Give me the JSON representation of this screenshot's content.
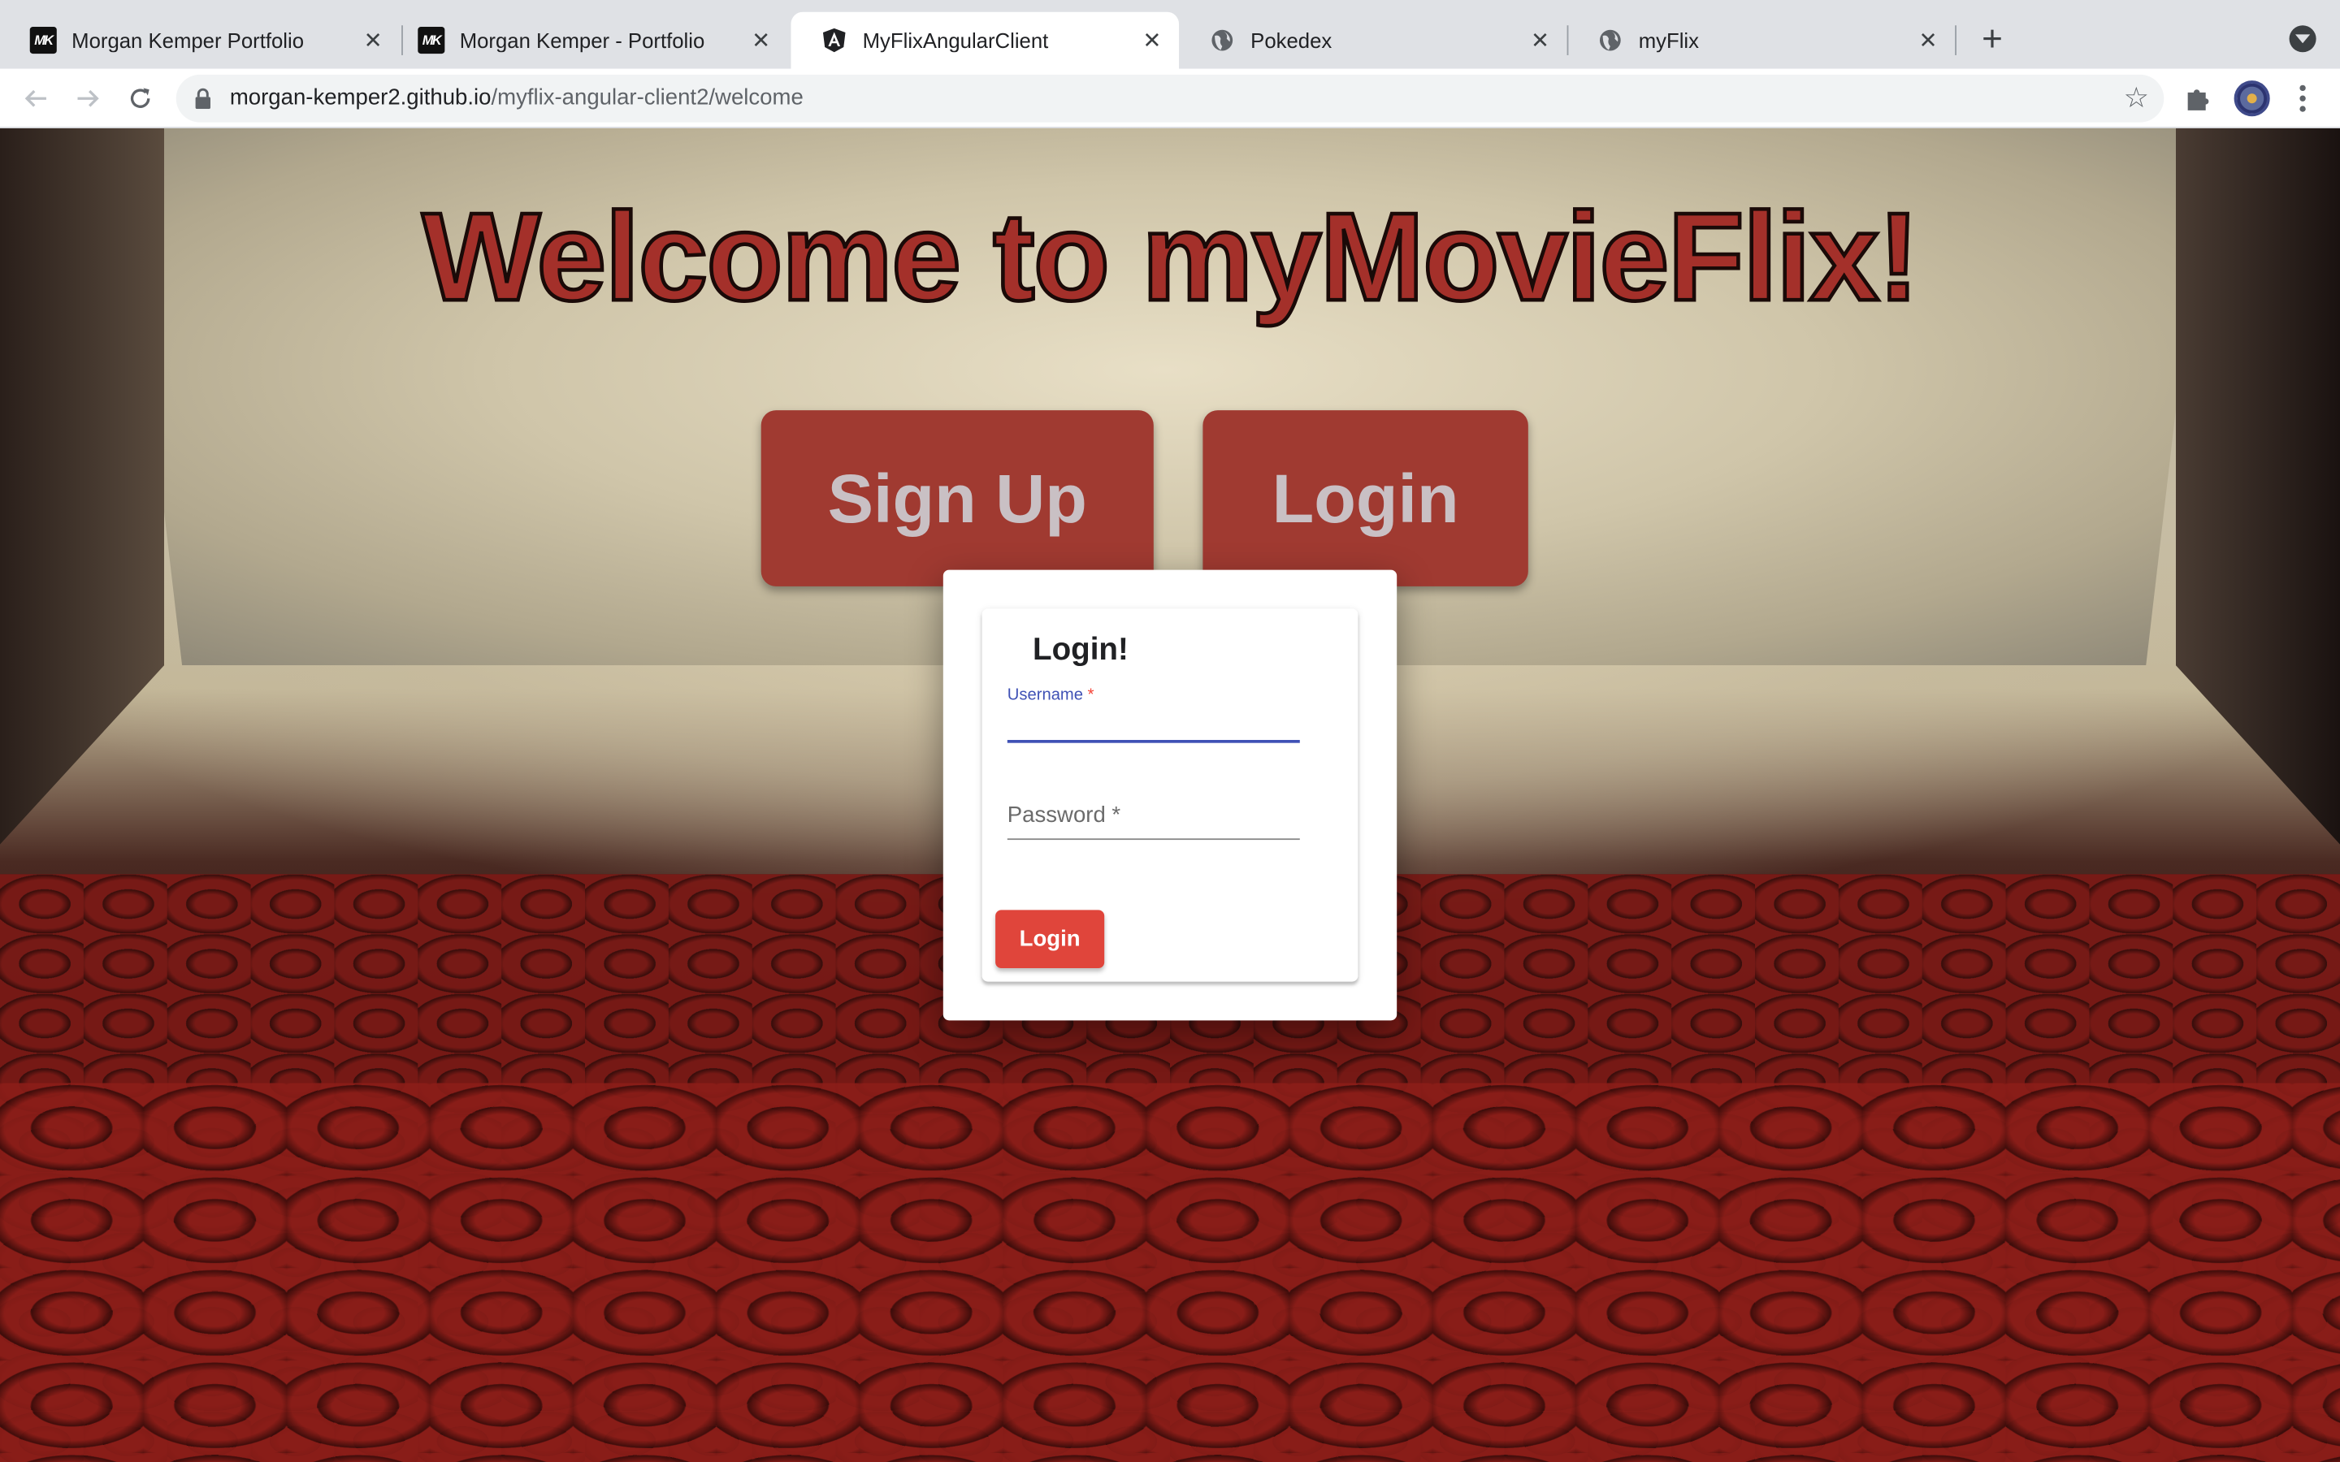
{
  "browser": {
    "tabs": [
      {
        "title": "Morgan Kemper Portfolio",
        "icon": "mk-logo-icon",
        "active": false
      },
      {
        "title": "Morgan Kemper - Portfolio",
        "icon": "mk-logo-icon",
        "active": false
      },
      {
        "title": "MyFlixAngularClient",
        "icon": "angular-icon",
        "active": true
      },
      {
        "title": "Pokedex",
        "icon": "globe-icon",
        "active": false
      },
      {
        "title": "myFlix",
        "icon": "globe-icon",
        "active": false
      }
    ],
    "close_glyph": "✕",
    "newtab_glyph": "+",
    "url": {
      "domain": "morgan-kemper2.github.io",
      "path": "/myflix-angular-client2/welcome"
    }
  },
  "page": {
    "headline": "Welcome to myMovieFlix!",
    "signup_label": "Sign Up",
    "login_label": "Login"
  },
  "dialog": {
    "title": "Login!",
    "username": {
      "label": "Username",
      "required_mark": "*",
      "value": ""
    },
    "password": {
      "placeholder": "Password *",
      "value": ""
    },
    "submit_label": "Login"
  },
  "colors": {
    "accent_indigo": "#3f51b5",
    "button_red": "#e0453b",
    "headline_red": "#a4302a",
    "big_button_red": "#a03a31"
  }
}
